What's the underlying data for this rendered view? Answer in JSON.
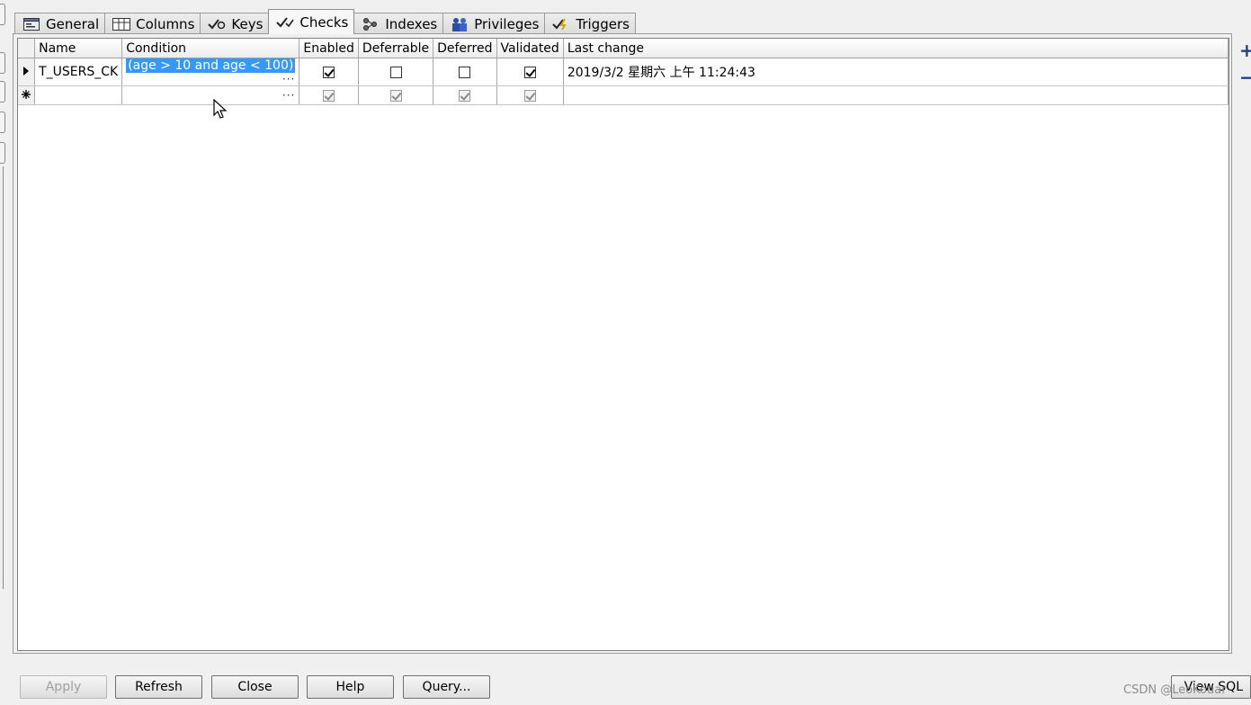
{
  "tabs": [
    {
      "label": "General",
      "icon": "general-icon"
    },
    {
      "label": "Columns",
      "icon": "columns-icon"
    },
    {
      "label": "Keys",
      "icon": "keys-icon"
    },
    {
      "label": "Checks",
      "icon": "checks-icon",
      "active": true
    },
    {
      "label": "Indexes",
      "icon": "indexes-icon"
    },
    {
      "label": "Privileges",
      "icon": "privileges-icon"
    },
    {
      "label": "Triggers",
      "icon": "triggers-icon"
    }
  ],
  "grid": {
    "headers": {
      "name": "Name",
      "condition": "Condition",
      "enabled": "Enabled",
      "deferrable": "Deferrable",
      "deferred": "Deferred",
      "validated": "Validated",
      "last_change": "Last change"
    },
    "rows": [
      {
        "indicator": "current",
        "name": "T_USERS_CK",
        "condition": "(age > 10 and age < 100)",
        "condition_ellipsis": "···",
        "enabled": true,
        "deferrable": false,
        "deferred": false,
        "validated": true,
        "last_change": "2019/3/2 星期六 上午 11:24:43"
      },
      {
        "indicator": "new",
        "name": "",
        "condition": "",
        "condition_ellipsis": "···",
        "enabled": true,
        "deferrable": true,
        "deferred": true,
        "validated": true,
        "last_change": ""
      }
    ]
  },
  "side": {
    "add": "+",
    "remove": "−"
  },
  "buttons": {
    "apply": "Apply",
    "refresh": "Refresh",
    "close": "Close",
    "help": "Help",
    "query": "Query...",
    "view_sql": "View SQL"
  },
  "watermark": "CSDN @LeoKouar",
  "colors": {
    "selection": "#3399ff",
    "accent": "#1d3f8a"
  }
}
